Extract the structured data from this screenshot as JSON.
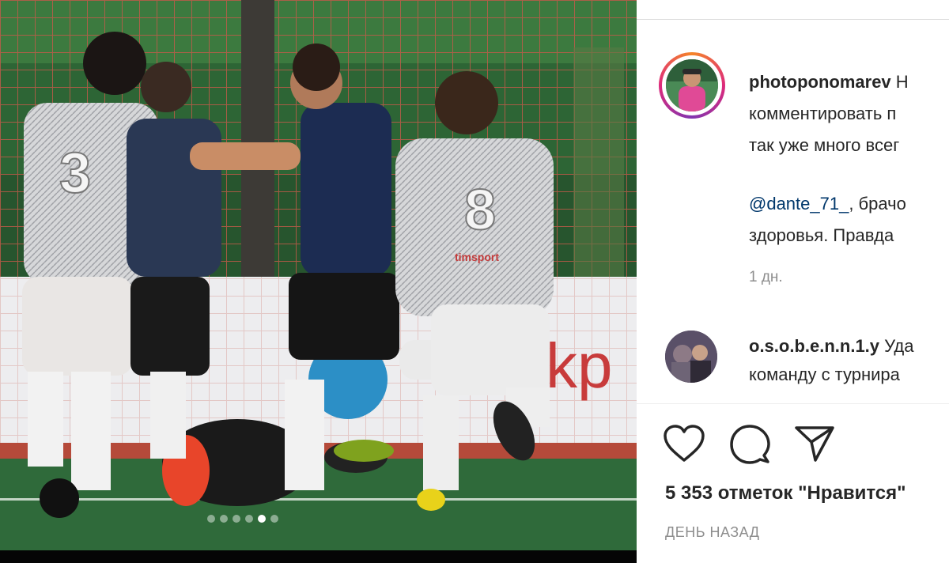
{
  "post": {
    "carousel": {
      "count": 6,
      "active_index": 4
    },
    "caption": {
      "username": "photoponomarev",
      "line1_rest": "Н",
      "line2": "комментировать п",
      "line3": "так уже много всег",
      "mention": "@dante_71_",
      "line4_rest": ", брачо",
      "line5": "здоровья. Правда"
    },
    "caption_time": "1 дн.",
    "comment": {
      "username": "o.s.o.b.e.n.n.1.y",
      "line1_rest": "Уда",
      "line2": "команду с турнира"
    },
    "actions": [
      {
        "name": "like",
        "icon": "heart-icon"
      },
      {
        "name": "comment",
        "icon": "comment-icon"
      },
      {
        "name": "share",
        "icon": "paper-plane-icon"
      }
    ],
    "likes_text": "5 353 отметок \"Нравится\"",
    "posted_ago": "ДЕНЬ НАЗАД"
  },
  "photo": {
    "jersey_numbers": [
      "3",
      "8"
    ],
    "shirt_logo": "timsport",
    "banner_text": "kp"
  },
  "colors": {
    "pitch": "#2f6a3a",
    "home_kit": "#1c2c52",
    "away_kit": "#d9dadc",
    "mention": "#00376b",
    "muted": "#8e8e8e"
  }
}
